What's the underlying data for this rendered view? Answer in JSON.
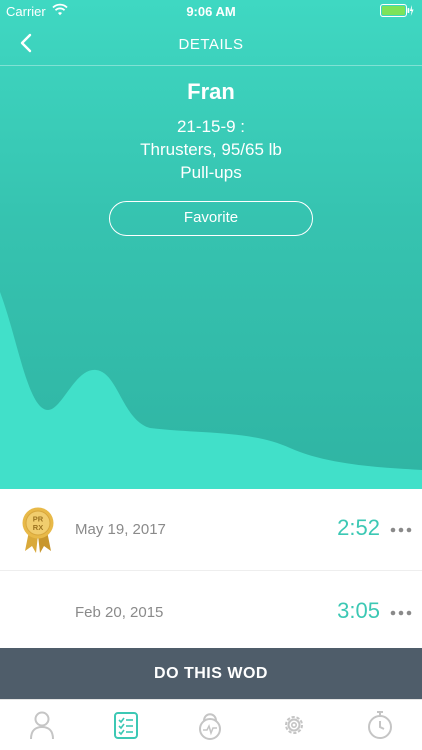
{
  "status_bar": {
    "carrier": "Carrier",
    "time": "9:06 AM",
    "icons": [
      "wifi-icon",
      "battery-icon"
    ]
  },
  "nav": {
    "title": "DETAILS",
    "back_icon": "back-chevron-icon"
  },
  "wod": {
    "name": "Fran",
    "description": [
      "21-15-9 :",
      "Thrusters, 95/65 lb",
      "Pull-ups"
    ],
    "favorite_label": "Favorite"
  },
  "results": [
    {
      "date": "May 19, 2017",
      "time": "2:52",
      "pr": true,
      "badge_text": [
        "PR",
        "RX"
      ]
    },
    {
      "date": "Feb 20, 2015",
      "time": "3:05",
      "pr": false
    }
  ],
  "action": {
    "label": "DO THIS WOD"
  },
  "tabs": [
    {
      "icon": "profile-icon",
      "active": false
    },
    {
      "icon": "checklist-icon",
      "active": true
    },
    {
      "icon": "kettlebell-icon",
      "active": false
    },
    {
      "icon": "settings-gear-icon",
      "active": false
    },
    {
      "icon": "stopwatch-icon",
      "active": false
    }
  ],
  "colors": {
    "accent": "#3cc8b4",
    "hero_top": "#3fd8c2",
    "hero_bottom": "#2fb4a3",
    "action_bar": "#4f5d6a",
    "tab_active": "#3cc8b4",
    "tab_inactive": "#c5c5c5"
  }
}
